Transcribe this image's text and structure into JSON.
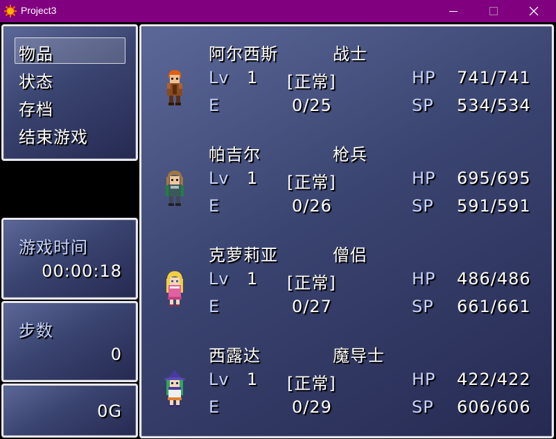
{
  "window": {
    "title": "Project3",
    "icon": "sun-icon"
  },
  "menu": {
    "items": [
      {
        "label": "物品"
      },
      {
        "label": "状态"
      },
      {
        "label": "存档"
      },
      {
        "label": "结束游戏"
      }
    ],
    "selected_index": 0
  },
  "playtime": {
    "label": "游戏时间",
    "value": "00:00:18"
  },
  "steps": {
    "label": "步数",
    "value": "0"
  },
  "gold": {
    "value": "0G"
  },
  "party": [
    {
      "name": "阿尔西斯",
      "class": "战士",
      "lv_label": "Lv",
      "level": "1",
      "state": "[正常]",
      "hp_label": "HP",
      "hp": "741/741",
      "exp_label": "E",
      "exp": "0/25",
      "sp_label": "SP",
      "sp": "534/534",
      "sprite": "warrior-sprite"
    },
    {
      "name": "帕吉尔",
      "class": "枪兵",
      "lv_label": "Lv",
      "level": "1",
      "state": "[正常]",
      "hp_label": "HP",
      "hp": "695/695",
      "exp_label": "E",
      "exp": "0/26",
      "sp_label": "SP",
      "sp": "591/591",
      "sprite": "lancer-sprite"
    },
    {
      "name": "克萝莉亚",
      "class": "僧侣",
      "lv_label": "Lv",
      "level": "1",
      "state": "[正常]",
      "hp_label": "HP",
      "hp": "486/486",
      "exp_label": "E",
      "exp": "0/27",
      "sp_label": "SP",
      "sp": "661/661",
      "sprite": "cleric-sprite"
    },
    {
      "name": "西露达",
      "class": "魔导士",
      "lv_label": "Lv",
      "level": "1",
      "state": "[正常]",
      "hp_label": "HP",
      "hp": "422/422",
      "exp_label": "E",
      "exp": "0/29",
      "sp_label": "SP",
      "sp": "606/606",
      "sprite": "mage-sprite"
    }
  ]
}
